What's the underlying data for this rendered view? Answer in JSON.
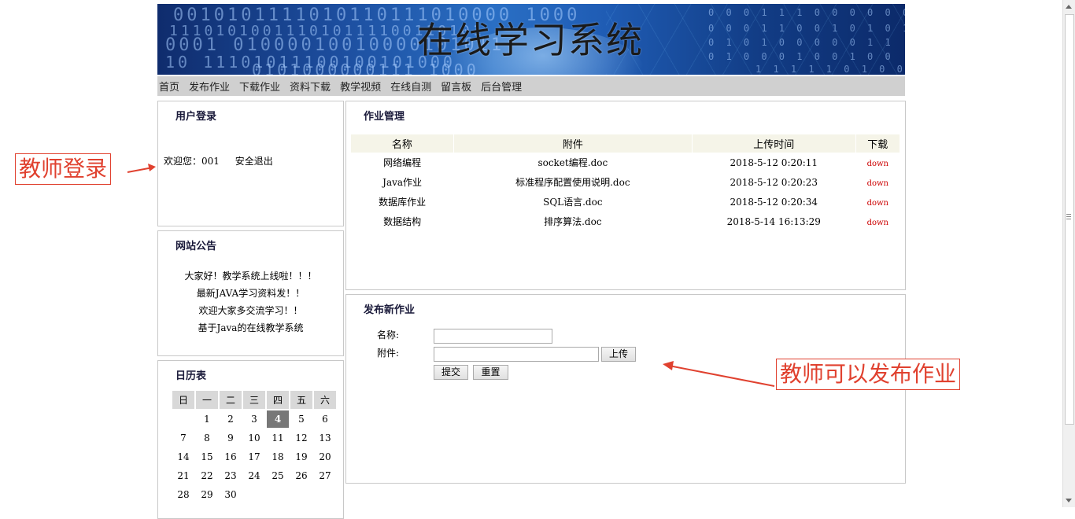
{
  "banner": {
    "title": "在线学习系统"
  },
  "nav": [
    "首页",
    "发布作业",
    "下载作业",
    "资料下载",
    "教学视频",
    "在线自测",
    "留言板",
    "后台管理"
  ],
  "login": {
    "heading": "用户登录",
    "welcome_label": "欢迎您：001",
    "logout": "安全退出"
  },
  "notices": {
    "heading": "网站公告",
    "items": [
      "大家好！教学系统上线啦！！！",
      "最新JAVA学习资料发！！",
      "欢迎大家多交流学习！！",
      "基于Java的在线教学系统"
    ]
  },
  "calendar": {
    "heading": "日历表",
    "weekdays": [
      "日",
      "一",
      "二",
      "三",
      "四",
      "五",
      "六"
    ],
    "today": "4",
    "weeks": [
      [
        "",
        "1",
        "2",
        "3",
        "4",
        "5",
        "6"
      ],
      [
        "7",
        "8",
        "9",
        "10",
        "11",
        "12",
        "13"
      ],
      [
        "14",
        "15",
        "16",
        "17",
        "18",
        "19",
        "20"
      ],
      [
        "21",
        "22",
        "23",
        "24",
        "25",
        "26",
        "27"
      ],
      [
        "28",
        "29",
        "30",
        "",
        "",
        "",
        ""
      ]
    ]
  },
  "homework": {
    "heading": "作业管理",
    "columns": [
      "名称",
      "附件",
      "上传时间",
      "下载"
    ],
    "rows": [
      [
        "网络编程",
        "socket编程.doc",
        "2018-5-12 0:20:11",
        "down"
      ],
      [
        "Java作业",
        "标准程序配置使用说明.doc",
        "2018-5-12 0:20:23",
        "down"
      ],
      [
        "数据库作业",
        "SQL语言.doc",
        "2018-5-12 0:20:34",
        "down"
      ],
      [
        "数据结构",
        "排序算法.doc",
        "2018-5-14 16:13:29",
        "down"
      ]
    ]
  },
  "publish": {
    "heading": "发布新作业",
    "name_label": "名称:",
    "file_label": "附件:",
    "upload_button": "上传",
    "submit_button": "提交",
    "reset_button": "重置"
  },
  "annotations": {
    "teacher_login": "教师登录",
    "teacher_publish": "教师可以发布作业"
  },
  "colors": {
    "annotation": "#e0412f",
    "down_link": "#cc0000",
    "nav_bg": "#d0d0d0"
  }
}
